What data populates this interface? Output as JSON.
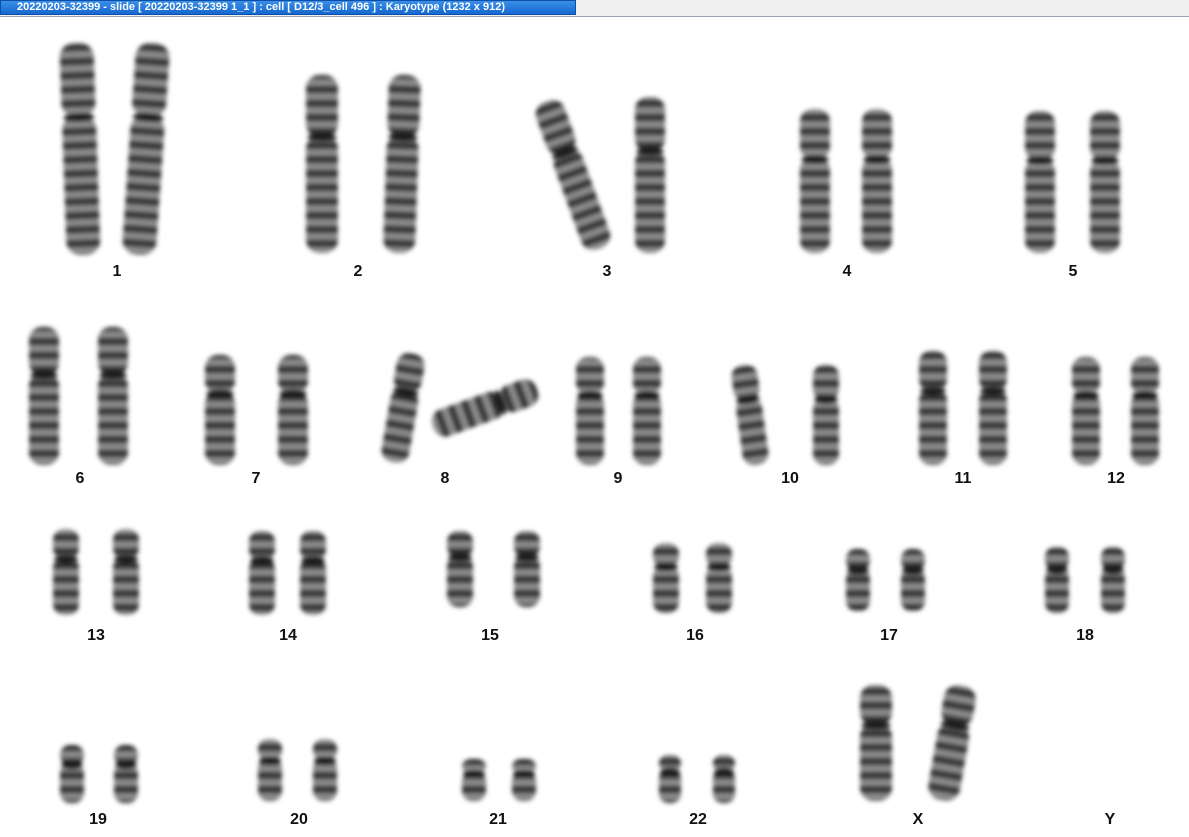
{
  "window": {
    "title": "20220203-32399 - slide [ 20220203-32399 1_1 ] : cell [ D12/3_cell 496 ] : Karyotype  (1232 x 912)"
  },
  "karyotype": {
    "chromosome_labels": [
      "1",
      "2",
      "3",
      "4",
      "5",
      "6",
      "7",
      "8",
      "9",
      "10",
      "11",
      "12",
      "13",
      "14",
      "15",
      "16",
      "17",
      "18",
      "19",
      "20",
      "21",
      "22",
      "X",
      "Y"
    ]
  }
}
